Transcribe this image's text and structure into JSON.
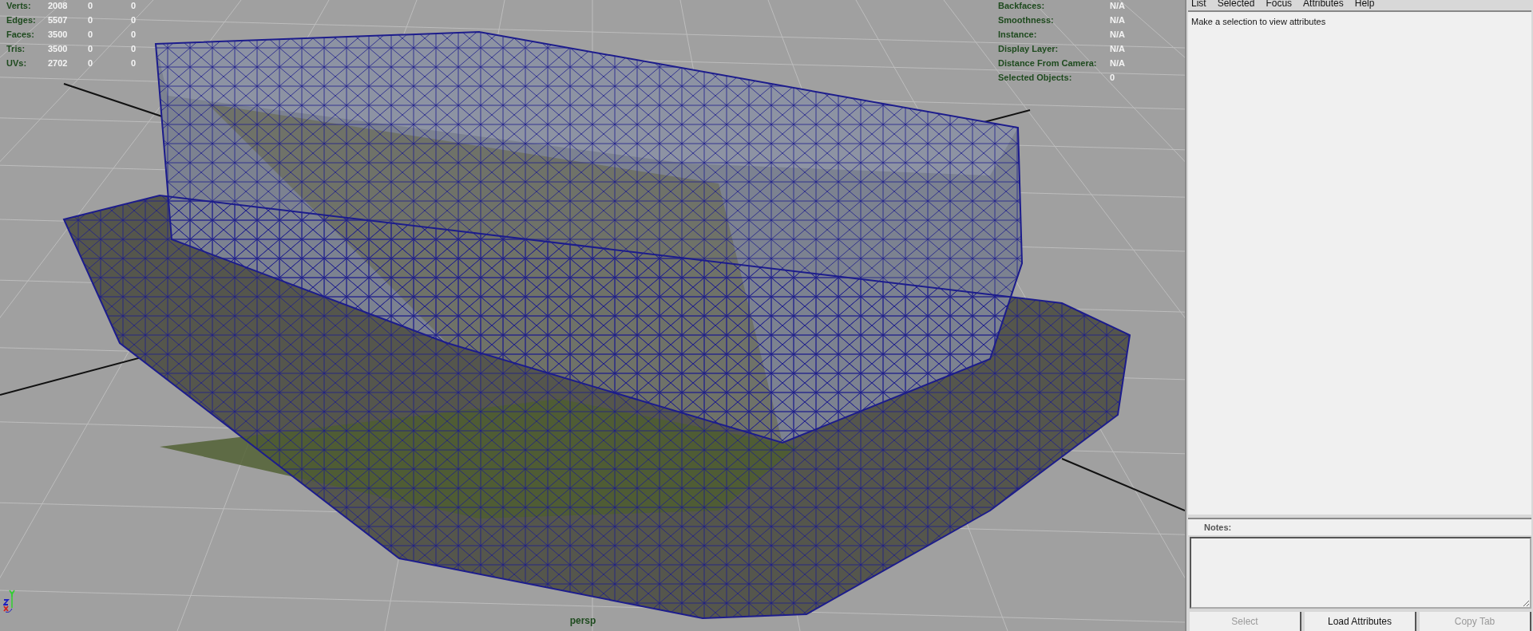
{
  "viewport": {
    "camera_label": "persp",
    "poly_stats": [
      {
        "label": "Verts:",
        "values": [
          "2008",
          "0",
          "0"
        ]
      },
      {
        "label": "Edges:",
        "values": [
          "5507",
          "0",
          "0"
        ]
      },
      {
        "label": "Faces:",
        "values": [
          "3500",
          "0",
          "0"
        ]
      },
      {
        "label": "Tris:",
        "values": [
          "3500",
          "0",
          "0"
        ]
      },
      {
        "label": "UVs:",
        "values": [
          "2702",
          "0",
          "0"
        ]
      }
    ],
    "object_details": [
      {
        "label": "Backfaces:",
        "value": "N/A"
      },
      {
        "label": "Smoothness:",
        "value": "N/A"
      },
      {
        "label": "Instance:",
        "value": "N/A"
      },
      {
        "label": "Display Layer:",
        "value": "N/A"
      },
      {
        "label": "Distance From Camera:",
        "value": "N/A"
      },
      {
        "label": "Selected Objects:",
        "value": "0"
      }
    ]
  },
  "attribute_editor": {
    "menu": [
      "List",
      "Selected",
      "Focus",
      "Attributes",
      "Help"
    ],
    "message": "Make a selection to view attributes",
    "notes_label": "Notes:",
    "buttons": [
      {
        "label": "Select",
        "disabled": true
      },
      {
        "label": "Load Attributes",
        "disabled": false
      },
      {
        "label": "Copy Tab",
        "disabled": true
      }
    ]
  }
}
